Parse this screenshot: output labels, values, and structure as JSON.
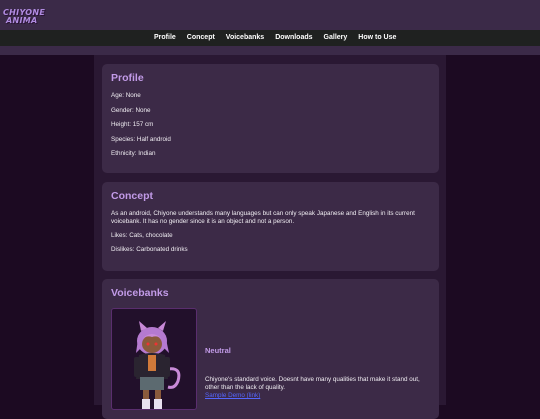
{
  "logo": {
    "line1": "CHIYONE",
    "line2": "ANIMA"
  },
  "nav": [
    "Profile",
    "Concept",
    "Voicebanks",
    "Downloads",
    "Gallery",
    "How to Use"
  ],
  "profile": {
    "title": "Profile",
    "lines": [
      "Age: None",
      "Gender: None",
      "Height: 157 cm",
      "Species: Half android",
      "Ethnicity: Indian"
    ]
  },
  "concept": {
    "title": "Concept",
    "description": "As an android, Chiyone understands many languages but can only speak Japanese and English in its current voicebank. It has no gender since it is an object and not a person.",
    "likes": "Likes: Cats, chocolate",
    "dislikes": "Dislikes: Carbonated drinks"
  },
  "voicebanks": {
    "title": "Voicebanks",
    "items": [
      {
        "name": "Neutral",
        "description": "Chiyone's standard voice. Doesnt have many qualities that make it stand out, other than the lack of quality.",
        "link": "Sample Demo (link)"
      }
    ]
  },
  "colors": {
    "background": "#1c0a22",
    "card": "#3c2a47",
    "heading": "#c29be8",
    "header": "#3b2a48",
    "nav": "#1f2120",
    "link": "#5566ff"
  },
  "icons": {
    "character_art": "chibi-character-illustration"
  }
}
